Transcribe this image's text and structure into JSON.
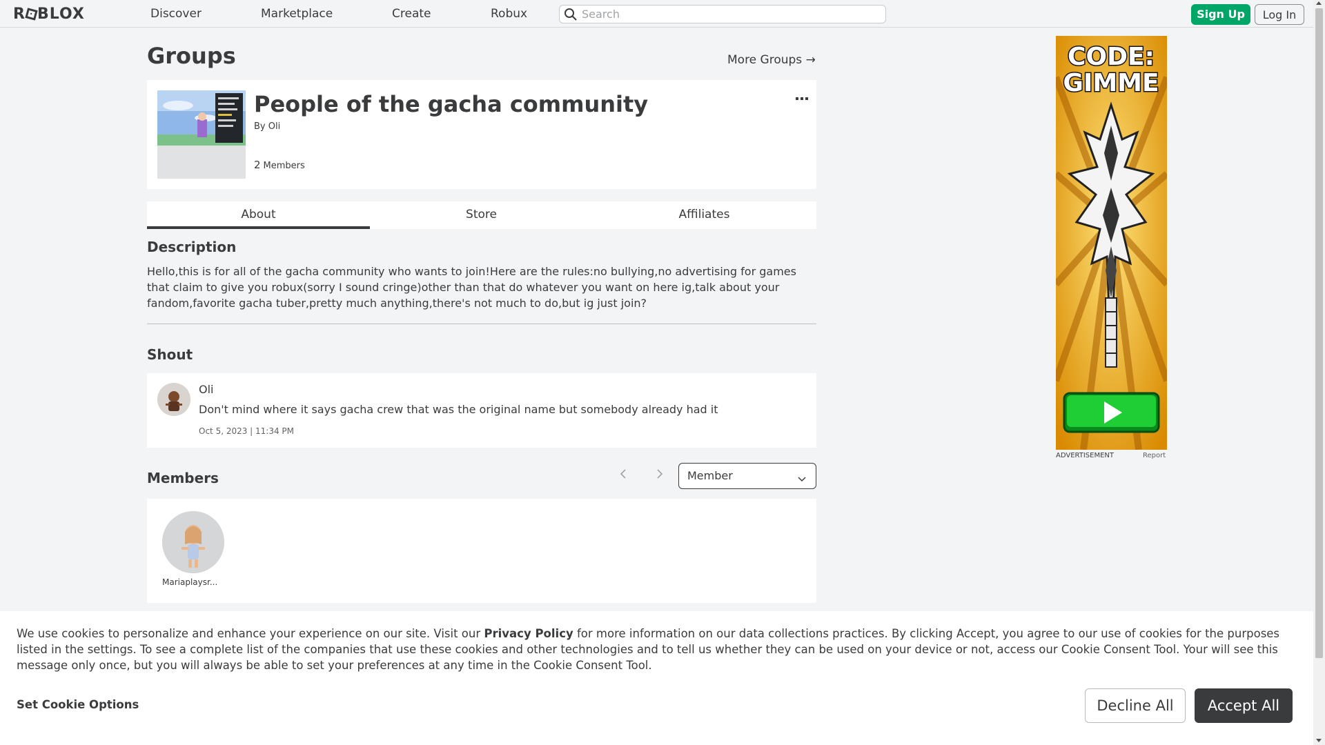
{
  "nav": {
    "logo": "ROBLOX",
    "links": [
      "Discover",
      "Marketplace",
      "Create",
      "Robux"
    ],
    "search_placeholder": "Search",
    "signup": "Sign Up",
    "login": "Log In"
  },
  "page": {
    "title": "Groups",
    "more_groups": "More Groups →"
  },
  "group": {
    "name": "People of the gacha community",
    "by_prefix": "By",
    "owner": "Oli",
    "member_count": "2",
    "member_label": "Members"
  },
  "tabs": [
    "About",
    "Store",
    "Affiliates"
  ],
  "about": {
    "description_title": "Description",
    "description": "Hello,this is for all of the gacha community who wants to join!Here are the rules:no bullying,no advertising for games that claim to give you robux(sorry I sound cringe)other than that do whatever you want on here ig,talk about your fandom,favorite gacha tuber,pretty much anything,there's not much to do,but ig just join?"
  },
  "shout": {
    "title": "Shout",
    "user": "Oli",
    "message": "Don't mind where it says gacha crew that was the original name but somebody already had it",
    "time": "Oct 5, 2023 | 11:34 PM"
  },
  "members": {
    "title": "Members",
    "role_selected": "Member",
    "list": [
      {
        "name": "Mariaplaysr..."
      }
    ]
  },
  "ad": {
    "headline_1": "CODE:",
    "headline_2": "GIMME",
    "label": "ADVERTISEMENT",
    "report": "Report"
  },
  "cookie": {
    "text_before": "We use cookies to personalize and enhance your experience on our site. Visit our ",
    "privacy_link": "Privacy Policy",
    "text_after": " for more information on our data collections practices. By clicking Accept, you agree to our use of cookies for the purposes listed in the settings. To see a complete list of the companies that use these cookies and other technologies and to tell us whether they can be used on your device or not, access our Cookie Consent Tool. Your will see this message only once, but you will always be able to set your preferences at any time in the Cookie Consent Tool.",
    "set_options": "Set Cookie Options",
    "decline": "Decline All",
    "accept": "Accept All"
  },
  "colors": {
    "page_bg": "#f2f4f5",
    "text": "#393b3d",
    "signup_green": "#00a665",
    "accept_dark": "#393b3d",
    "ad_yellow": "#f0a000",
    "ad_play_green": "#18c030"
  }
}
